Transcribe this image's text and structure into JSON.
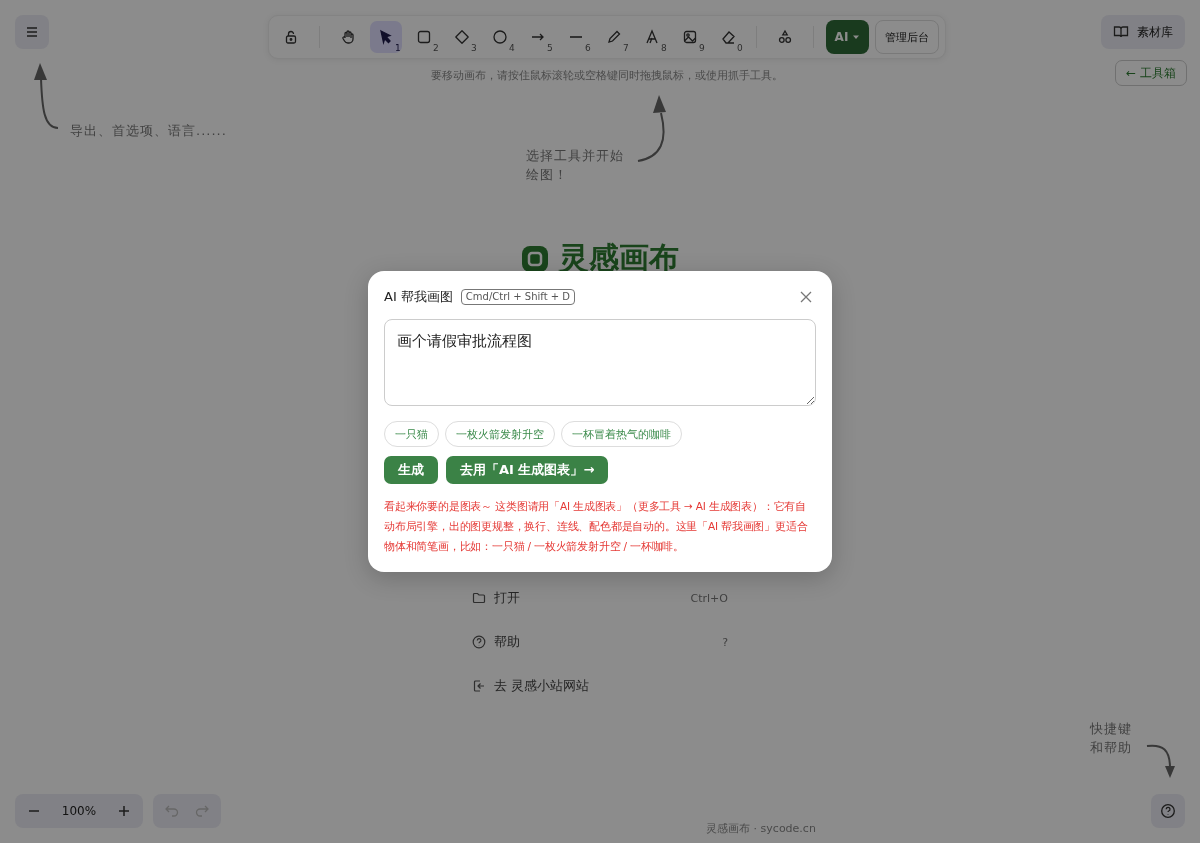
{
  "toolbar": {
    "tools": [
      {
        "kind": "lock",
        "selected": false
      },
      {
        "kind": "hand",
        "selected": false
      },
      {
        "kind": "select",
        "key": "1",
        "selected": true
      },
      {
        "kind": "rectangle",
        "key": "2",
        "selected": false
      },
      {
        "kind": "diamond",
        "key": "3",
        "selected": false
      },
      {
        "kind": "ellipse",
        "key": "4",
        "selected": false
      },
      {
        "kind": "arrow",
        "key": "5",
        "selected": false
      },
      {
        "kind": "line",
        "key": "6",
        "selected": false
      },
      {
        "kind": "pencil",
        "key": "7",
        "selected": false
      },
      {
        "kind": "text",
        "key": "8",
        "selected": false
      },
      {
        "kind": "image",
        "key": "9",
        "selected": false
      },
      {
        "kind": "eraser",
        "key": "0",
        "selected": false
      },
      {
        "kind": "shapes",
        "selected": false
      }
    ],
    "ai_button": "AI",
    "admin_button": "管理后台"
  },
  "canvas_hint": "要移动画布，请按住鼠标滚轮或空格键同时拖拽鼠标，或使用抓手工具。",
  "library_button": "素材库",
  "toolbox_button": "← 工具箱",
  "menu_hint": "导出、首选项、语言......",
  "tool_hint": [
    "选择工具并开始",
    "绘图！"
  ],
  "help_hint": [
    "快捷键",
    "和帮助"
  ],
  "welcome": {
    "logo": "灵感画布",
    "items": [
      {
        "kind": "open",
        "label": "打开",
        "shortcut": "Ctrl+O"
      },
      {
        "kind": "help",
        "label": "帮助",
        "shortcut": "?"
      },
      {
        "kind": "link",
        "label": "去 灵感小站网站"
      }
    ]
  },
  "zoom": {
    "value": "100%"
  },
  "undo": {
    "disabled": true
  },
  "redo": {
    "disabled": true
  },
  "footer": "灵感画布 · sycode.cn",
  "dialog": {
    "title": "AI 帮我画图",
    "shortcut": "Cmd/Ctrl + Shift + D",
    "prompt": "画个请假审批流程图",
    "suggestions": [
      "一只猫",
      "一枚火箭发射升空",
      "一杯冒着热气的咖啡"
    ],
    "buttons": [
      "生成",
      "去用「AI 生成图表」→"
    ],
    "warning": "看起来你要的是图表～ 这类图请用「AI 生成图表」（更多工具 → AI 生成图表）：它有自动布局引擎，出的图更规整，换行、连线、配色都是自动的。这里「AI 帮我画图」更适合物体和简笔画，比如：一只猫 / 一枚火箭发射升空 / 一杯咖啡。"
  }
}
